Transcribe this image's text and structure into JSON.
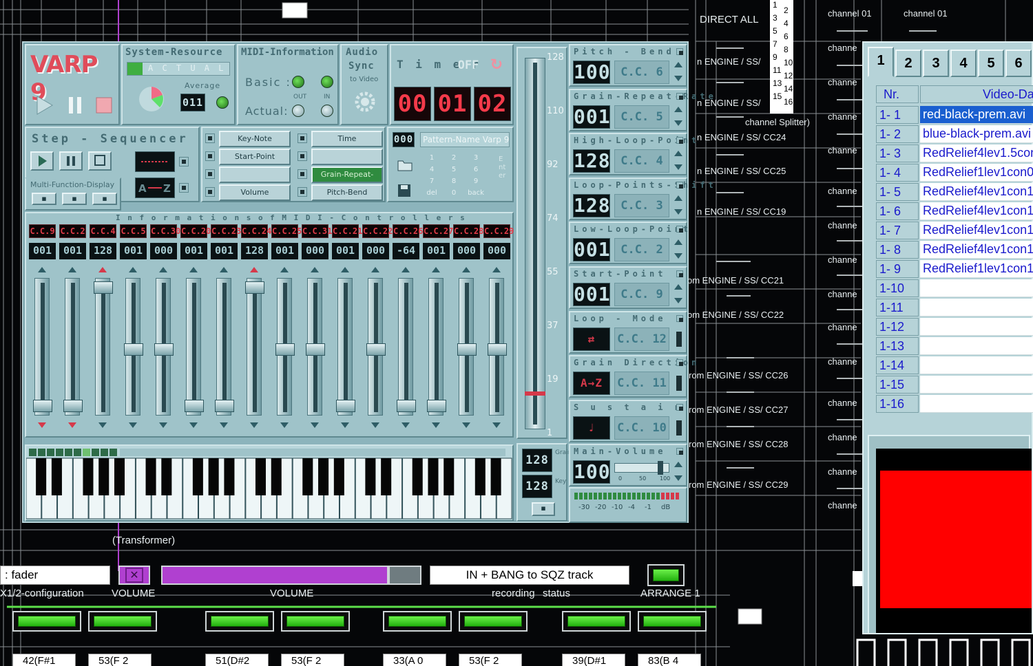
{
  "patch": {
    "direct_all": "DIRECT ALL",
    "channel_labels": [
      "channel 01",
      "channel 01"
    ],
    "channe_label": "channe",
    "engine_routes": [
      "n ENGINE / SS/",
      "n ENGINE / SS/",
      "n ENGINE / SS/ CC24",
      "n ENGINE / SS/ CC25",
      "n ENGINE / SS/ CC19",
      "om ENGINE / SS/ CC21",
      "om ENGINE / SS/ CC22",
      "rom ENGINE / SS/ CC26",
      "rom ENGINE / SS/ CC27",
      "rom ENGINE / SS/ CC28",
      "rom ENGINE / SS/ CC29"
    ],
    "splitter_label": "channel Splitter)",
    "splitter_numbers": [
      "1",
      "2",
      "3",
      "4",
      "5",
      "6",
      "7",
      "8",
      "9",
      "10",
      "11",
      "12",
      "13",
      "14",
      "15",
      "16"
    ],
    "transformer_label": "(Transformer)"
  },
  "varp": {
    "logo": "VARP 9",
    "system_resource": {
      "title": "System-Resource",
      "actual": "A C T U A L",
      "average_label": "Average",
      "average_value": "011"
    },
    "midi_info": {
      "title": "MIDI-Information",
      "basic_label": "Basic :",
      "actual_label": "Actual:",
      "out_label": "OUT",
      "in_label": "IN"
    },
    "audio_sync": {
      "title_1": "Audio",
      "title_2": "Sync",
      "subtitle": "to Video"
    },
    "timer": {
      "title": "T i m e r",
      "off_label": "OFF",
      "digits": [
        "00",
        "01",
        "02"
      ]
    },
    "step_sequencer": {
      "title": "Step - Sequencer",
      "buttons": [
        "Key-Note",
        "Start-Point",
        "",
        "Volume",
        "Time",
        "",
        "Grain-Repeat-Rate",
        "Pitch-Bend"
      ]
    },
    "multi_function": {
      "title": "Multi-Function-Display"
    },
    "pattern": {
      "number": "000",
      "name": "Pattern-Name Varp 9",
      "keypad": [
        "1",
        "2",
        "3",
        "4",
        "5",
        "6",
        "7",
        "8",
        "9",
        "del",
        "0",
        "back"
      ],
      "enter_label": "Enter"
    },
    "controllers_title": "I n f o r m a t i o n s   o f   M I D I - C o n t r o l l e r s",
    "controllers": [
      {
        "cc": "C.C.9",
        "value": "001",
        "level": 0.02
      },
      {
        "cc": "C.C.2",
        "value": "001",
        "level": 0.02
      },
      {
        "cc": "C.C.4",
        "value": "128",
        "level": 0.98
      },
      {
        "cc": "C.C.5",
        "value": "001",
        "level": 0.48
      },
      {
        "cc": "C.C.30",
        "value": "000",
        "level": 0.48
      },
      {
        "cc": "C.C.20",
        "value": "001",
        "level": 0.02
      },
      {
        "cc": "C.C.23",
        "value": "001",
        "level": 0.02
      },
      {
        "cc": "C.C.24",
        "value": "128",
        "level": 0.98
      },
      {
        "cc": "C.C.25",
        "value": "001",
        "level": 0.48
      },
      {
        "cc": "C.C.31",
        "value": "000",
        "level": 0.48
      },
      {
        "cc": "C.C.21",
        "value": "001",
        "level": 0.02
      },
      {
        "cc": "C.C.22",
        "value": "000",
        "level": 0.48
      },
      {
        "cc": "C.C.26",
        "value": "-64",
        "level": 0.02
      },
      {
        "cc": "C.C.27",
        "value": "001",
        "level": 0.02
      },
      {
        "cc": "C.C.28",
        "value": "000",
        "level": 0.48
      },
      {
        "cc": "C.C.29",
        "value": "000",
        "level": 0.48
      }
    ],
    "master_scale": [
      "128",
      "110",
      "92",
      "74",
      "55",
      "37",
      "19",
      "1"
    ],
    "master_level": 0.08,
    "small_lcds": [
      "128",
      "128"
    ],
    "grain_label": "Grain",
    "key_label": "Key",
    "params": [
      {
        "title": "Pitch - Bend",
        "value": "100",
        "cc": "C.C. 6"
      },
      {
        "title": "Grain-Repeat-Rate",
        "value": "001",
        "cc": "C.C. 5"
      },
      {
        "title": "High-Loop-Point",
        "value": "128",
        "cc": "C.C. 4"
      },
      {
        "title": "Loop-Points-Shift",
        "value": "128",
        "cc": "C.C. 3"
      },
      {
        "title": "Low-Loop-Point",
        "value": "001",
        "cc": "C.C. 2"
      },
      {
        "title": "Start-Point",
        "value": "001",
        "cc": "C.C. 9"
      },
      {
        "title": "Loop - Mode",
        "value": "",
        "cc": "C.C. 12"
      },
      {
        "title": "Grain Direction",
        "value": "",
        "cc": "C.C. 11"
      },
      {
        "title": "S u s t a i n",
        "value": "",
        "cc": "C.C. 10"
      },
      {
        "title": "Main-Volume",
        "value": "100",
        "cc": ""
      }
    ],
    "main_volume_scale": [
      "0",
      "50",
      "100"
    ],
    "meter_scale": [
      "-30",
      "-20",
      "-10",
      "-4",
      "-1",
      "dB"
    ]
  },
  "video_window": {
    "tabs": [
      "1",
      "2",
      "3",
      "4",
      "5",
      "6"
    ],
    "col_nr": "Nr.",
    "col_video": "Video-Da",
    "rows": [
      {
        "nr": "1- 1",
        "file": "red-black-prem.avi"
      },
      {
        "nr": "1- 2",
        "file": "blue-black-prem.avi"
      },
      {
        "nr": "1- 3",
        "file": "RedRelief4lev1.5con"
      },
      {
        "nr": "1- 4",
        "file": "RedRelief1lev1con0"
      },
      {
        "nr": "1- 5",
        "file": "RedRelief4lev1con1"
      },
      {
        "nr": "1- 6",
        "file": "RedRelief4lev1con1"
      },
      {
        "nr": "1- 7",
        "file": "RedRelief4lev1con1"
      },
      {
        "nr": "1- 8",
        "file": "RedRelief4lev1con1"
      },
      {
        "nr": "1- 9",
        "file": "RedRelief1lev1con1"
      },
      {
        "nr": "1-10",
        "file": ""
      },
      {
        "nr": "1-11",
        "file": ""
      },
      {
        "nr": "1-12",
        "file": ""
      },
      {
        "nr": "1-13",
        "file": ""
      },
      {
        "nr": "1-14",
        "file": ""
      },
      {
        "nr": "1-15",
        "file": ""
      },
      {
        "nr": "1-16",
        "file": ""
      }
    ]
  },
  "bottom": {
    "fader_box": ": fader",
    "bang_box": "IN + BANG to SQZ track",
    "labels": [
      "X1/2-configuration",
      "VOLUME",
      "VOLUME",
      "recording",
      "status",
      "ARRANGE 1"
    ],
    "note_boxes": [
      "42(F#1",
      "53(F 2",
      "51(D#2",
      "53(F 2",
      "33(A 0",
      "53(F 2",
      "39(D#1",
      "83(B 4"
    ]
  }
}
